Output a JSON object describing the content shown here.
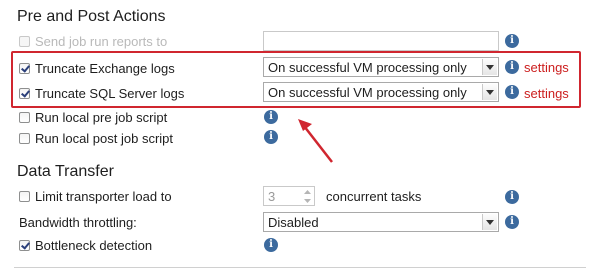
{
  "pre_post": {
    "title": "Pre and Post Actions",
    "send_reports": {
      "label": "Send job run reports to",
      "checked": false,
      "disabled": true,
      "value": ""
    },
    "truncate_exchange": {
      "label": "Truncate Exchange logs",
      "checked": true,
      "option": "On successful VM processing only",
      "settings_label": "settings"
    },
    "truncate_sql": {
      "label": "Truncate SQL Server logs",
      "checked": true,
      "option": "On successful VM processing only",
      "settings_label": "settings"
    },
    "run_pre": {
      "label": "Run local pre job script",
      "checked": false
    },
    "run_post": {
      "label": "Run local post job script",
      "checked": false
    }
  },
  "data_transfer": {
    "title": "Data Transfer",
    "limit_load": {
      "label": "Limit transporter load to",
      "checked": false,
      "value": "3",
      "suffix": "concurrent tasks"
    },
    "bandwidth": {
      "label": "Bandwidth throttling:",
      "option": "Disabled"
    },
    "bottleneck": {
      "label": "Bottleneck detection",
      "checked": true
    }
  },
  "info_glyph": "i",
  "colors": {
    "accent_red": "#d0262f",
    "info_blue": "#3c6a9e",
    "settings_red": "#cc1e1e"
  }
}
